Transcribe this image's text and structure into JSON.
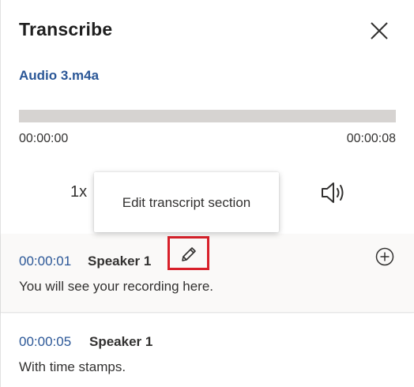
{
  "header": {
    "title": "Transcribe",
    "close_icon": "close-icon"
  },
  "file": {
    "name": "Audio 3.m4a"
  },
  "player": {
    "progress": 0,
    "time_start": "00:00:00",
    "time_end": "00:00:08",
    "speed_label": "1x",
    "volume_icon": "volume-icon"
  },
  "tooltip": {
    "text": "Edit transcript section"
  },
  "segments": [
    {
      "time": "00:00:01",
      "speaker": "Speaker 1",
      "text": "You will see your recording here.",
      "edit_icon": "pencil-icon",
      "add_icon": "plus-circle-icon"
    },
    {
      "time": "00:00:05",
      "speaker": "Speaker 1",
      "text": "With time stamps."
    }
  ],
  "colors": {
    "link": "#2b5797",
    "highlight": "#d8202a",
    "track": "#d6d3d1"
  }
}
